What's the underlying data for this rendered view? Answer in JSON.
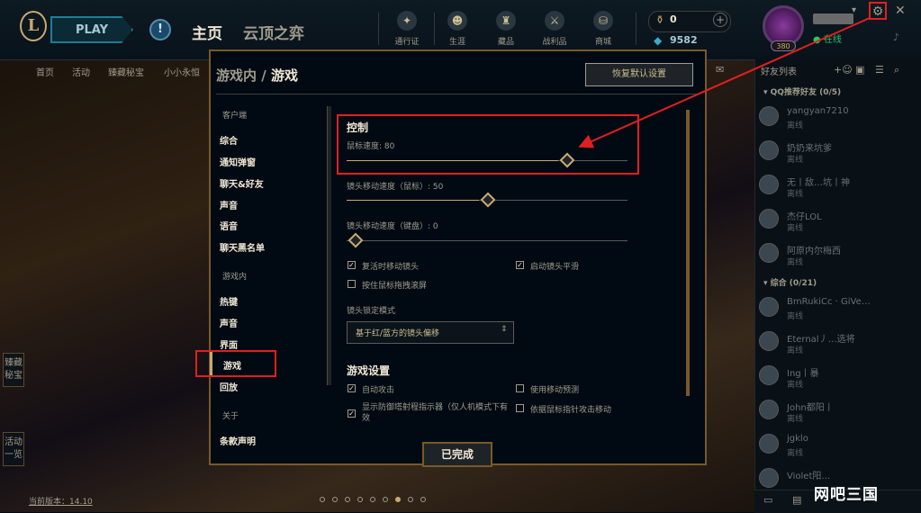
{
  "topbar": {
    "play_label": "PLAY",
    "alert_label": "!",
    "logo_label": "L",
    "nav_home": "主页",
    "nav_tft": "云顶之弈",
    "nav_icons": [
      {
        "icon": "pass-icon",
        "label": "通行证"
      },
      {
        "icon": "profile-icon",
        "label": "生涯"
      },
      {
        "icon": "collection-icon",
        "label": "藏品"
      },
      {
        "icon": "loot-icon",
        "label": "战利品"
      },
      {
        "icon": "store-icon",
        "label": "商城"
      }
    ],
    "rp_value": "0",
    "be_value": "9582",
    "level": "380",
    "status": "● 在线",
    "gear_glyph": "⚙",
    "close_glyph": "✕",
    "bell_glyph": "🔔",
    "min_glyph": "▾"
  },
  "subnav": [
    "首页",
    "活动",
    "臻藏秘宝",
    "小小永恒"
  ],
  "side_tabs": [
    "臻藏秘宝",
    "活动一览"
  ],
  "version": "当前版本：14.10",
  "modal": {
    "breadcrumb_parent": "游戏内",
    "breadcrumb_sep": " / ",
    "breadcrumb_current": "游戏",
    "reset_label": "恢复默认设置",
    "nav": {
      "client_header": "客户端",
      "client_items": [
        "综合",
        "通知弹窗",
        "聊天&好友",
        "声音",
        "语音",
        "聊天黑名单"
      ],
      "ingame_header": "游戏内",
      "ingame_items": [
        "热键",
        "声音",
        "界面",
        "游戏",
        "回放"
      ],
      "about_header": "关于",
      "about_items": [
        "条款声明"
      ]
    },
    "control_title": "控制",
    "mouse_speed_label": "鼠标速度: 80",
    "mouse_speed_value": 80,
    "cam_mouse_label": "镜头移动速度（鼠标）: 50",
    "cam_mouse_value": 50,
    "cam_kb_label": "镜头移动速度（键盘）: 0",
    "cam_kb_value": 0,
    "checks1": [
      {
        "label": "复活时移动镜头",
        "checked": true
      },
      {
        "label": "启动镜头平滑",
        "checked": true
      },
      {
        "label": "按住鼠标拖拽滚屏",
        "checked": false
      }
    ],
    "lock_mode_label": "镜头锁定模式",
    "lock_mode_value": "基于红/蓝方的镜头偏移",
    "select_arrow": "⌃⌄",
    "game_settings_title": "游戏设置",
    "checks2": [
      {
        "label": "自动攻击",
        "checked": true
      },
      {
        "label": "使用移动预测",
        "checked": false
      },
      {
        "label": "显示防御塔射程指示器（仅人机模式下有效",
        "checked": true
      },
      {
        "label": "依据鼠标指针攻击移动",
        "checked": false
      }
    ],
    "done_label": "已完成"
  },
  "friends": {
    "title": "好友列表",
    "group1": "▾ QQ推荐好友 (0/5)",
    "group1_rows": [
      {
        "name": "yangyan7210",
        "status": "离线"
      },
      {
        "name": "奶奶来坑爹",
        "status": "离线"
      },
      {
        "name": "无丨敌…坑丨神",
        "status": "离线"
      },
      {
        "name": "杰仔LOL",
        "status": "离线"
      },
      {
        "name": "阿原内尔梅西",
        "status": "离线"
      }
    ],
    "group2": "▾ 综合 (0/21)",
    "group2_rows": [
      {
        "name": "BmRukiCc · GiVe…",
        "status": "离线"
      },
      {
        "name": "Eternal丿…选将",
        "status": "离线"
      },
      {
        "name": "Ing丨暴",
        "status": "离线"
      },
      {
        "name": "John都阳丨",
        "status": "离线"
      },
      {
        "name": "jgklo",
        "status": "离线"
      },
      {
        "name": "Violet阳…",
        "status": ""
      }
    ],
    "watermark": "网吧三国"
  },
  "colors": {
    "accent": "#c8aa6e",
    "highlight_red": "#e02020"
  }
}
